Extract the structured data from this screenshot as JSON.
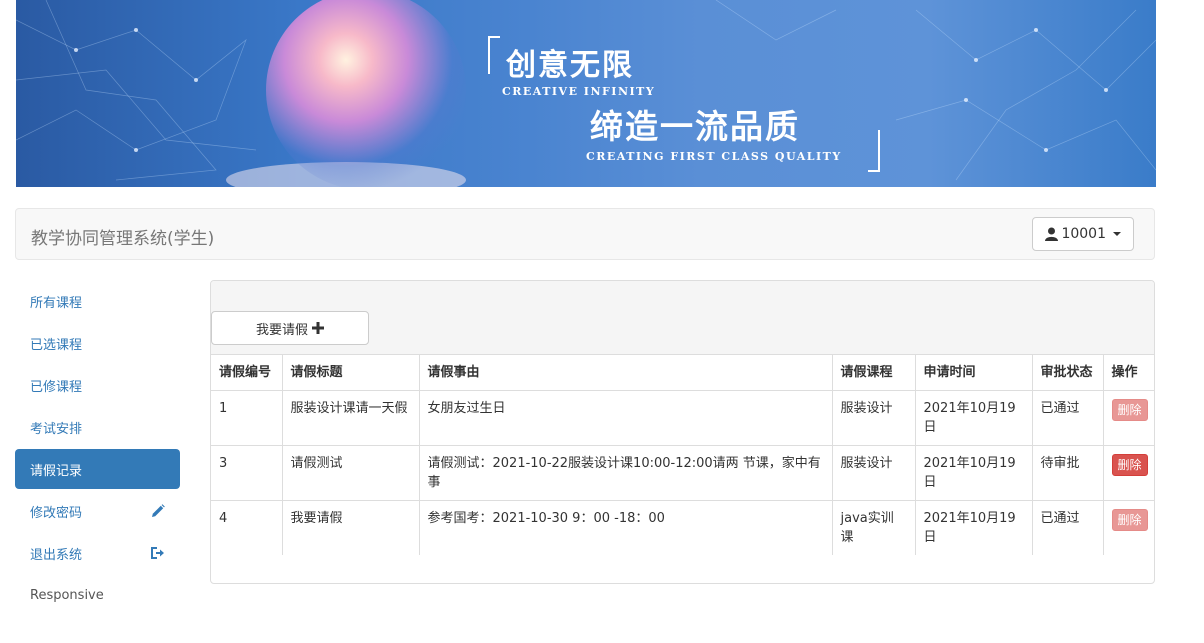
{
  "banner": {
    "title_cn": "创意无限",
    "title_en": "CREATIVE INFINITY",
    "subtitle_cn": "缔造一流品质",
    "subtitle_en": "CREATING FIRST CLASS QUALITY"
  },
  "navbar": {
    "brand": "教学协同管理系统(学生)",
    "user": "10001",
    "user_icon": "user-icon"
  },
  "sidebar": {
    "items": [
      {
        "label": "所有课程"
      },
      {
        "label": "已选课程"
      },
      {
        "label": "已修课程"
      },
      {
        "label": "考试安排"
      },
      {
        "label": "请假记录",
        "active": true
      },
      {
        "label": "修改密码",
        "icon": "pencil-icon"
      },
      {
        "label": "退出系统",
        "icon": "logout-icon"
      },
      {
        "label": "Responsive"
      }
    ]
  },
  "main": {
    "add_button": "我要请假",
    "add_icon": "plus-icon",
    "table": {
      "headers": [
        "请假编号",
        "请假标题",
        "请假事由",
        "请假课程",
        "申请时间",
        "审批状态",
        "操作"
      ],
      "rows": [
        {
          "id": "1",
          "title": "服装设计课请一天假",
          "reason": "女朋友过生日",
          "course": "服装设计",
          "time": "2021年10月19日",
          "status": "已通过",
          "action": "删除",
          "enabled": false
        },
        {
          "id": "3",
          "title": "请假测试",
          "reason": "请假测试：2021-10-22服装设计课10:00-12:00请两 节课，家中有事",
          "course": "服装设计",
          "time": "2021年10月19日",
          "status": "待审批",
          "action": "删除",
          "enabled": true
        },
        {
          "id": "4",
          "title": "我要请假",
          "reason": "参考国考：2021-10-30 9：00 -18：00",
          "course": "java实训课",
          "time": "2021年10月19日",
          "status": "已通过",
          "action": "删除",
          "enabled": false
        }
      ]
    }
  },
  "colors": {
    "primary": "#337ab7",
    "danger": "#d9534f"
  }
}
